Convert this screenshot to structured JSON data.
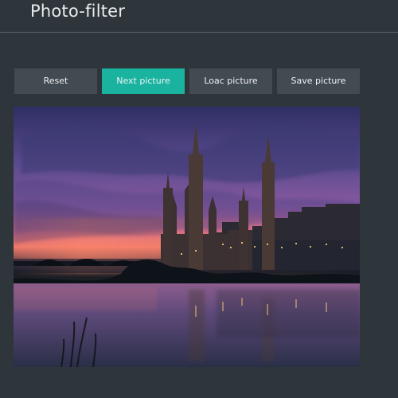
{
  "app": {
    "title": "Photo-filter"
  },
  "toolbar": {
    "reset_label": "Reset",
    "next_label": "Next picture",
    "load_label": "Loac picture",
    "save_label": "Save picture"
  },
  "colors": {
    "background": "#2e353b",
    "button": "#434b52",
    "accent": "#19b3a0",
    "text": "#eef2f3"
  },
  "image": {
    "subject": "cathedral-at-dusk-river-reflection-photo"
  }
}
